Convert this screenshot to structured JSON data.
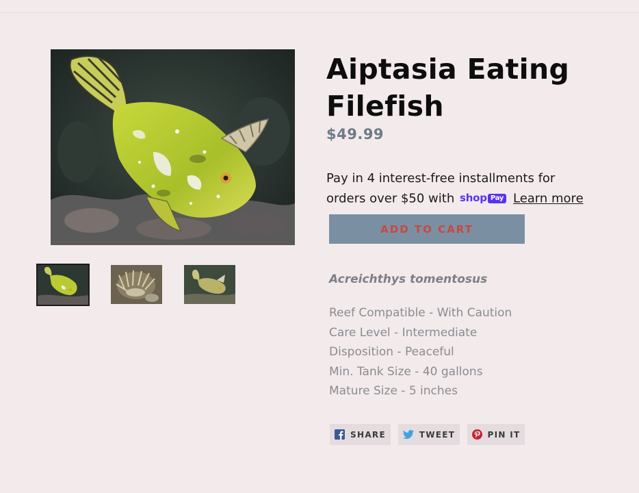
{
  "product": {
    "title": "Aiptasia Eating Filefish",
    "price": "$49.99",
    "scientific_name": "Acreichthys tomentosus",
    "specs": [
      "Reef Compatible - With Caution",
      "Care Level - Intermediate",
      "Disposition - Peaceful",
      "Min. Tank Size - 40 gallons",
      "Mature Size - 5 inches"
    ]
  },
  "installments": {
    "line1": "Pay in 4 interest-free installments for",
    "line2": "orders over $50 with",
    "shop_word": "shop",
    "pay_word": "Pay",
    "learn_more": "Learn more"
  },
  "cart": {
    "button_label": "ADD TO CART"
  },
  "social": {
    "share_label": "SHARE",
    "tweet_label": "TWEET",
    "pin_label": "PIN IT"
  },
  "colors": {
    "page_background": "#f3eaec",
    "button_background": "#7b8fa3",
    "button_text": "#c8483f",
    "price": "#6f7b88",
    "shop_pay": "#5a31f4",
    "facebook": "#3b5998",
    "twitter": "#3ea4e0",
    "pinterest": "#c8232c"
  }
}
